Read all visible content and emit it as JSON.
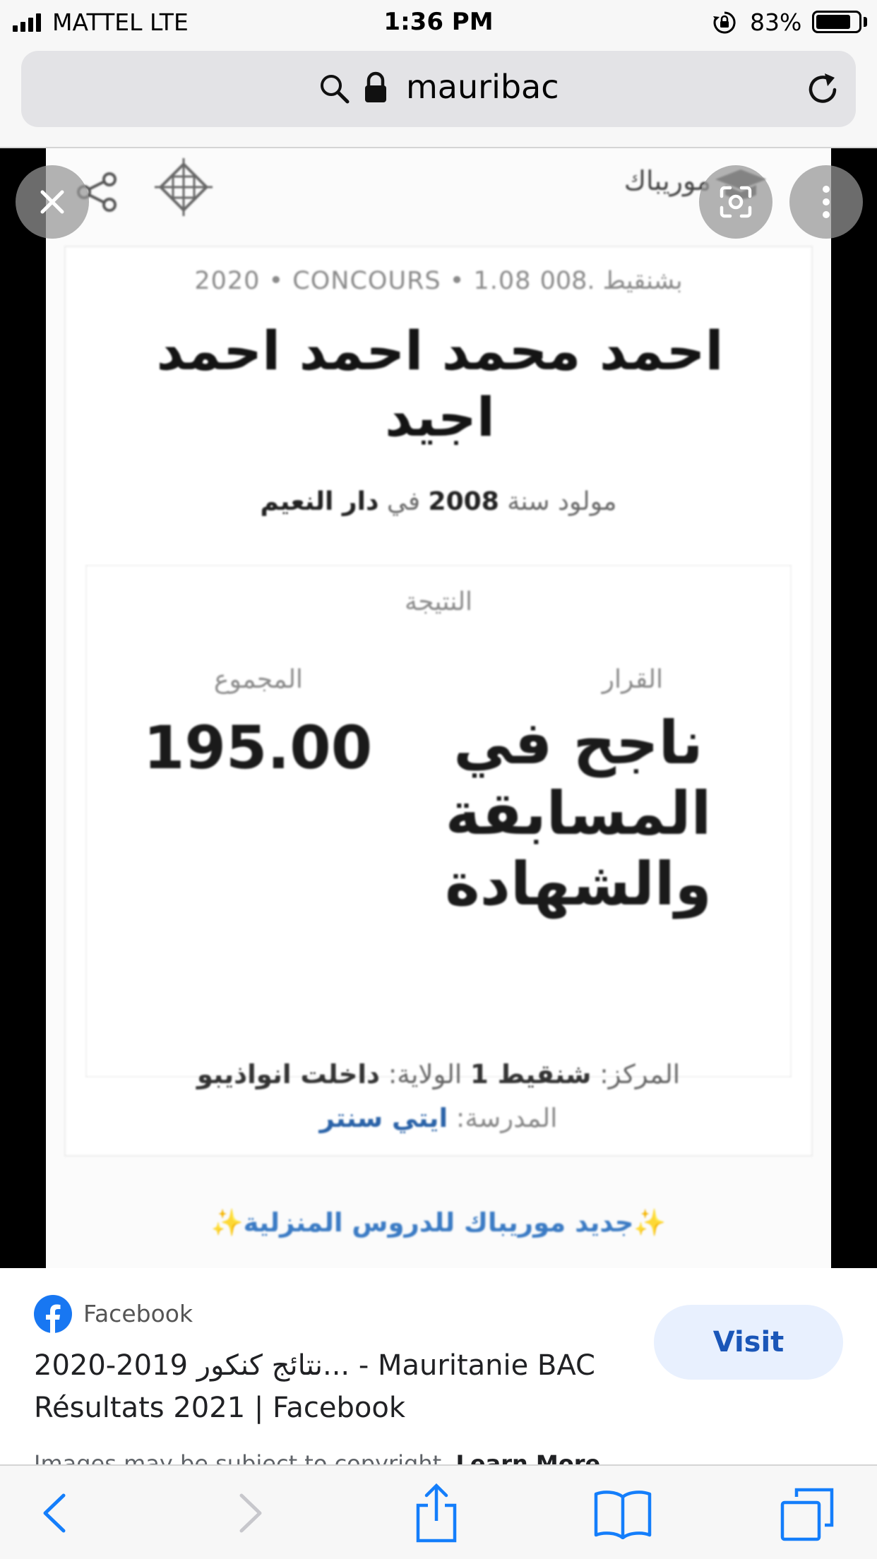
{
  "status_bar": {
    "carrier": "MATTEL   LTE",
    "time": "1:36 PM",
    "battery_percent": "83%",
    "battery_level": 0.83
  },
  "address_bar": {
    "url_text": "mauribac",
    "icons": [
      "search-icon",
      "lock-icon",
      "reload-icon"
    ]
  },
  "image": {
    "site_name": "موريباك",
    "meta_line": "2020 • CONCOURS • 1.08 بشنقيط .008",
    "student_name": "احمد محمد احمد احمد اجيد",
    "born_prefix": "مولود سنة",
    "born_year": "2008",
    "born_in": "في",
    "born_place": "دار النعيم",
    "result_heading": "النتيجة",
    "decision_label": "القرار",
    "decision_value": "ناجح في المسابقة والشهادة",
    "total_label": "المجموع",
    "total_value": "195.00",
    "center_label": "المركز:",
    "center_value": "شنقيط 1",
    "wilaya_label": "الولاية:",
    "wilaya_value": "داخلت انواذيبو",
    "school_label": "المدرسة:",
    "school_value": "ايتي سنتر",
    "promo_sparkle": "✨",
    "promo_text": "جديد موريباك للدروس المنزلية"
  },
  "info_panel": {
    "source": "Facebook",
    "title": "2020-2019 نتائج كنكور... - Mauritanie BAC Résultats 2021 | Facebook",
    "visit_label": "Visit",
    "copyright_text": "Images may be subject to copyright.",
    "learn_more": "Learn More"
  },
  "toolbar": {
    "icons": [
      "back-icon",
      "forward-icon",
      "share-icon",
      "bookmarks-icon",
      "tabs-icon"
    ]
  },
  "colors": {
    "visit_bg": "#e8f0fe",
    "visit_text": "#1a56b8",
    "ios_blue": "#147efb",
    "facebook_blue": "#1877f2"
  }
}
